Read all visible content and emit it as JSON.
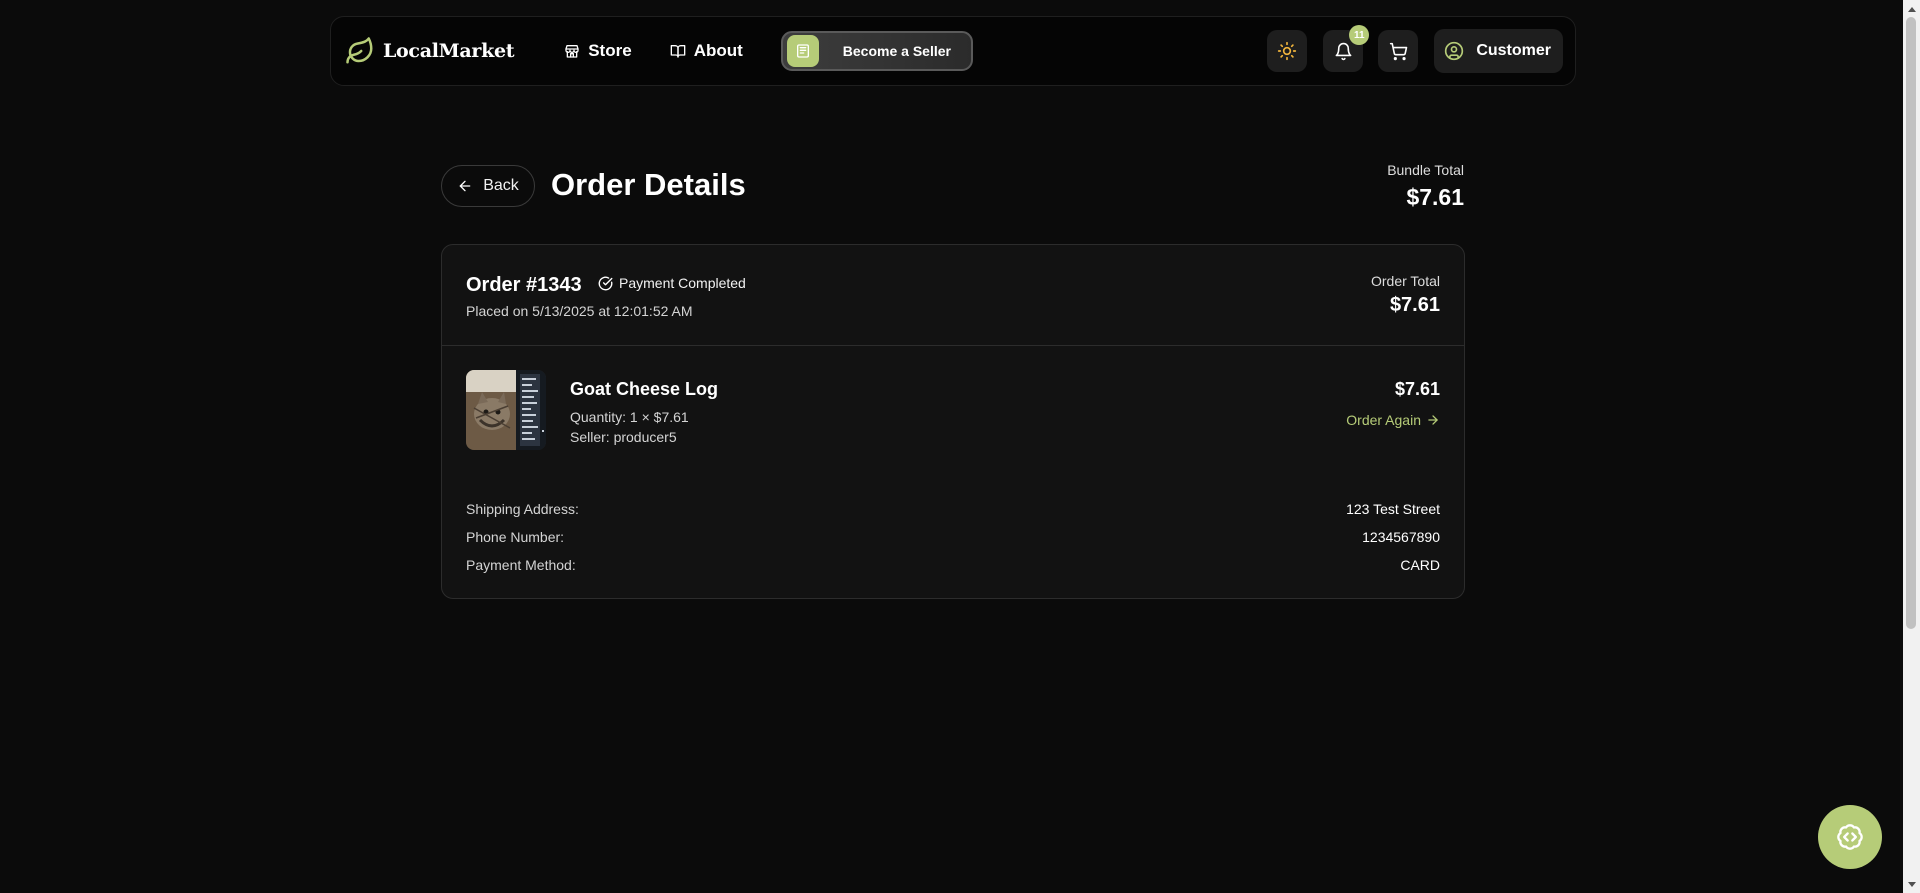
{
  "nav": {
    "logo_text": "LocalMarket",
    "links": [
      {
        "label": "Store",
        "icon": "store-icon"
      },
      {
        "label": "About",
        "icon": "book-icon"
      }
    ],
    "become_seller_label": "Become a Seller",
    "notification_count": "11",
    "user_label": "Customer"
  },
  "page": {
    "back_label": "Back",
    "title": "Order Details",
    "bundle_total_label": "Bundle Total",
    "bundle_total_value": "$7.61"
  },
  "order": {
    "number": "Order #1343",
    "payment_status": "Payment Completed",
    "placed_on": "Placed on 5/13/2025 at 12:01:52 AM",
    "order_total_label": "Order Total",
    "order_total_value": "$7.61",
    "item": {
      "name": "Goat Cheese Log",
      "quantity": "Quantity: 1 × $7.61",
      "seller": "Seller: producer5",
      "price": "$7.61",
      "order_again_label": "Order Again"
    },
    "details": [
      {
        "key": "Shipping Address:",
        "value": "123 Test Street"
      },
      {
        "key": "Phone Number:",
        "value": "1234567890"
      },
      {
        "key": "Payment Method:",
        "value": "CARD"
      }
    ]
  },
  "colors": {
    "accent": "#b6cc78",
    "background": "#0b0b0b",
    "card": "#121212"
  }
}
